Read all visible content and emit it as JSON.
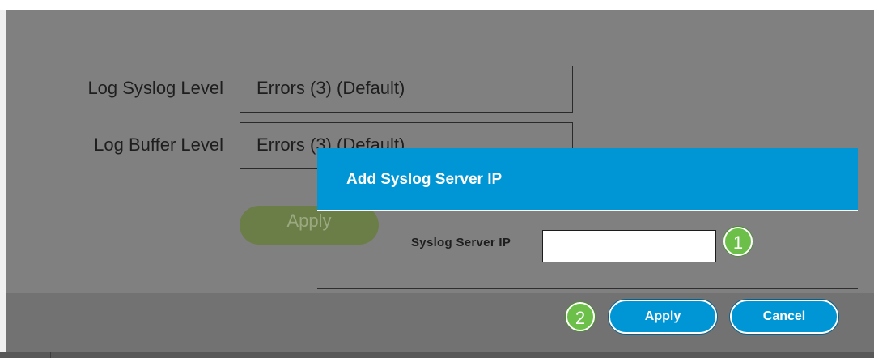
{
  "settings_form": {
    "log_syslog_level_label": "Log Syslog Level",
    "log_syslog_level_value": "Errors (3) (Default)",
    "log_buffer_level_label": "Log Buffer Level",
    "log_buffer_level_value": "Errors (3) (Default)",
    "apply_label": "Apply"
  },
  "dialog": {
    "title": "Add Syslog Server IP",
    "ip_label": "Syslog Server IP",
    "ip_value": "",
    "ip_placeholder": "",
    "apply_label": "Apply",
    "cancel_label": "Cancel"
  },
  "callouts": {
    "step_1": "1",
    "step_2": "2"
  },
  "colors": {
    "dialog_header": "#0096d6",
    "button_primary": "#0096d6",
    "callout_badge": "#6cc04a",
    "apply_main_disabled": "#6c7e47",
    "overlay": "#808080"
  }
}
